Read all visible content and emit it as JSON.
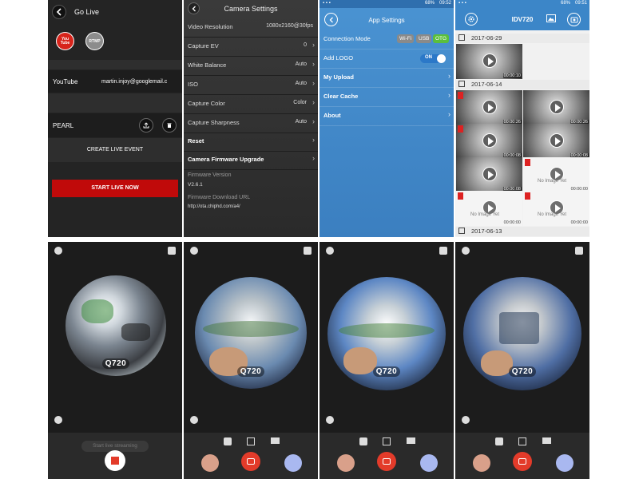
{
  "go_live": {
    "title": "Go Live",
    "youtube_badge": "You Tube",
    "rtmp_badge": "RTMP",
    "youtube_row_label": "YouTube",
    "youtube_account": "martin.injoy@googlemail.c",
    "pearl_row_label": "PEARL",
    "create_event_label": "CREATE LIVE EVENT",
    "start_live_label": "START LIVE NOW",
    "colors": {
      "start_live_bg": "#c00a0a",
      "youtube_red": "#d7241b",
      "rtmp_gray": "#8c8c8c"
    }
  },
  "camera_settings": {
    "title": "Camera Settings",
    "rows": [
      {
        "label": "Video Resolution",
        "value": "1080x2160@30fps"
      },
      {
        "label": "Capture EV",
        "value": "0"
      },
      {
        "label": "White Balance",
        "value": "Auto"
      },
      {
        "label": "ISO",
        "value": "Auto"
      },
      {
        "label": "Capture Color",
        "value": "Color"
      },
      {
        "label": "Capture Sharpness",
        "value": "Auto"
      },
      {
        "label": "Reset",
        "value": ""
      },
      {
        "label": "Camera Firmware Upgrade",
        "value": ""
      }
    ],
    "firmware_version_label": "Firmware Version",
    "firmware_version": "V2.6.1",
    "firmware_url_label": "Firmware Download URL",
    "firmware_url": "http://ota.chiphd.com/a4/"
  },
  "app_settings": {
    "status_time": "09:52",
    "status_battery": "68%",
    "title": "App Settings",
    "connection_mode_label": "Connection Mode",
    "connection_options": [
      "Wi-Fi",
      "USB",
      "OTG"
    ],
    "connection_selected": "OTG",
    "add_logo_label": "Add LOGO",
    "add_logo_toggle": "ON",
    "my_upload_label": "My Upload",
    "clear_cache_label": "Clear Cache",
    "about_label": "About",
    "colors": {
      "otg_green": "#5bbf3c",
      "toggle_blue": "#2b78c8"
    }
  },
  "album": {
    "status_time": "09:51",
    "status_battery": "68%",
    "title": "IDV720",
    "groups": [
      {
        "date": "2017-06-29",
        "thumbs": [
          {
            "duration": "00:00:10",
            "no_image": false
          }
        ]
      },
      {
        "date": "2017-06-14",
        "thumbs": [
          {
            "duration": "00:00:26",
            "no_image": false
          },
          {
            "duration": "00:00:26",
            "no_image": false
          },
          {
            "duration": "00:00:08",
            "no_image": false
          },
          {
            "duration": "00:00:08",
            "no_image": false
          },
          {
            "duration": "00:00:08",
            "no_image": false
          },
          {
            "duration": "00:00:00",
            "no_image": true
          },
          {
            "duration": "00:00:00",
            "no_image": true
          },
          {
            "duration": "00:00:00",
            "no_image": true
          }
        ]
      },
      {
        "date": "2017-06-13",
        "thumbs": []
      }
    ],
    "no_image_text": "No Image Yet"
  },
  "live_views": {
    "brand": "Q720",
    "start_streaming_label": "Start live streaming",
    "colors": {
      "record_red": "#e33b2a",
      "filter_blue": "#a9b8f0",
      "beauty_peach": "#d9a08a"
    }
  }
}
